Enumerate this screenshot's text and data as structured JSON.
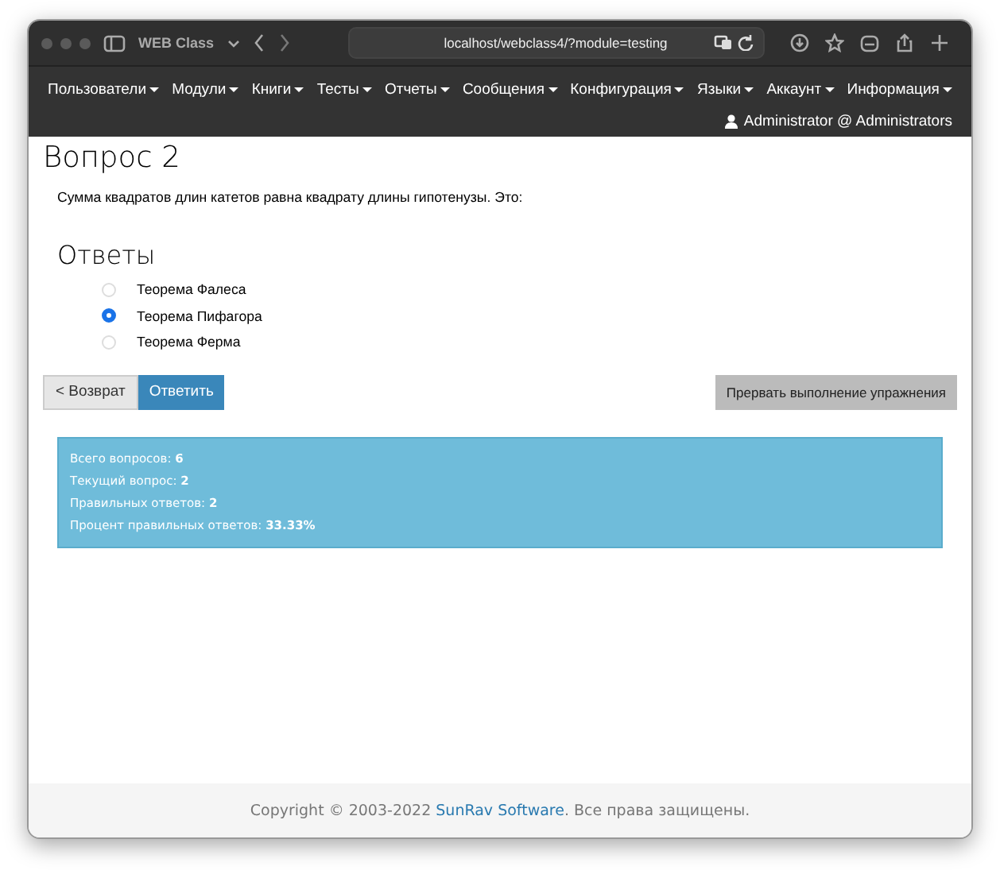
{
  "browser": {
    "tab_title": "WEB Class",
    "url": "localhost/webclass4/?module=testing"
  },
  "menu": [
    "Пользователи",
    "Модули",
    "Книги",
    "Тесты",
    "Отчеты",
    "Сообщения",
    "Конфигурация",
    "Языки",
    "Аккаунт",
    "Информация"
  ],
  "user": "Administrator @ Administrators",
  "question": {
    "title": "Вопрос 2",
    "text": "Сумма квадратов длин катетов равна квадрату длины гипотенузы. Это:"
  },
  "answers": {
    "title": "Ответы",
    "options": [
      {
        "label": "Теорема Фалеса",
        "selected": false
      },
      {
        "label": "Теорема Пифагора",
        "selected": true
      },
      {
        "label": "Теорема Ферма",
        "selected": false
      }
    ]
  },
  "buttons": {
    "back": "< Возврат",
    "submit": "Ответить",
    "abort": "Прервать выполнение упражнения"
  },
  "stats": [
    "Всего вопросов: **6**",
    "Текущий вопрос: **2**",
    "Правильных ответов: **2**",
    "Процент правильных ответов: **33.33%**"
  ],
  "footer": {
    "prefix": "Copyright © 2003-2022 ",
    "link": "SunRav Software",
    "suffix": ". Все права защищены."
  }
}
